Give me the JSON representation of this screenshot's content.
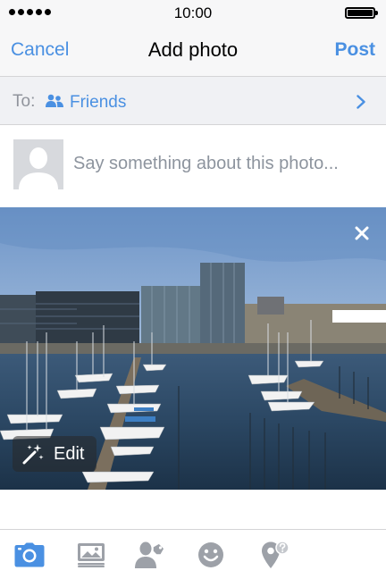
{
  "status_bar": {
    "time": "10:00"
  },
  "nav": {
    "cancel_label": "Cancel",
    "title": "Add photo",
    "post_label": "Post"
  },
  "audience": {
    "to_label": "To:",
    "value": "Friends",
    "icon": "friends-icon"
  },
  "composer": {
    "placeholder": "Say something about this photo..."
  },
  "photo": {
    "edit_label": "Edit",
    "remove_icon": "close-icon"
  },
  "toolbar": {
    "items": [
      "camera-icon",
      "photo-album-icon",
      "tag-people-icon",
      "emoji-icon",
      "check-in-icon"
    ]
  },
  "colors": {
    "accent": "#4a90e2",
    "toolbar_active": "#4a90e2",
    "toolbar_inactive": "#9da1a8",
    "bar_background": "#f7f7f8"
  }
}
